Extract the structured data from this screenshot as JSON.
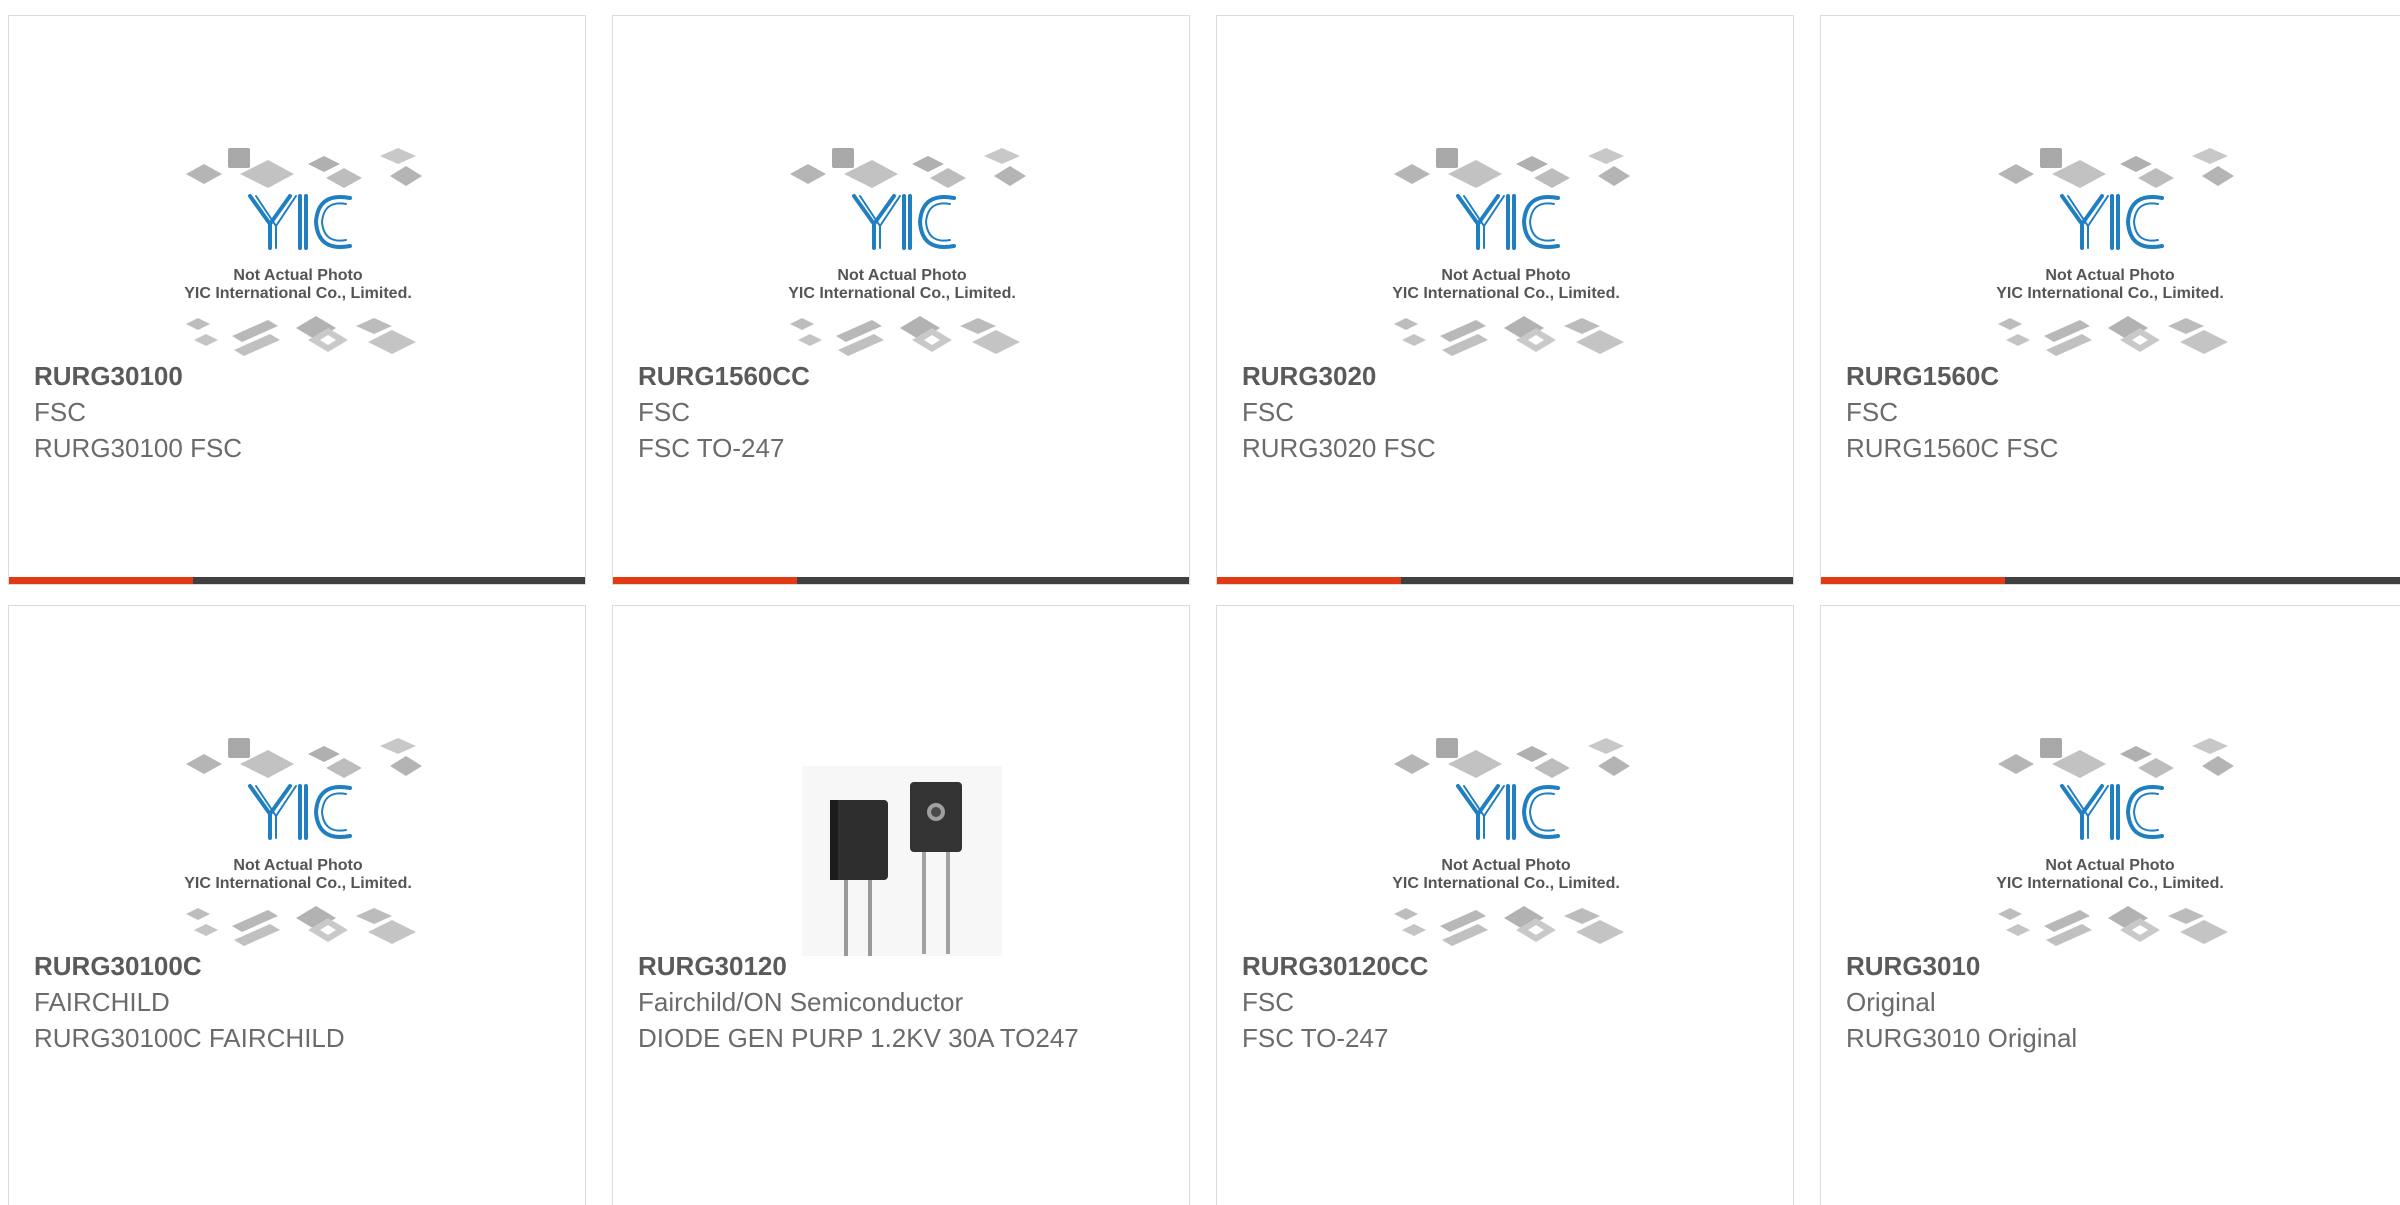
{
  "placeholder": {
    "line1": "Not Actual Photo",
    "line2": "YIC International Co., Limited.",
    "logo": "YIC"
  },
  "colors": {
    "accent": "#e23a12",
    "bar": "#404040",
    "logo": "#1f7fc1",
    "chip": "#b9b9b9"
  },
  "products": [
    {
      "part": "RURG30100",
      "brand": "FSC",
      "desc": "RURG30100 FSC",
      "image": "placeholder"
    },
    {
      "part": "RURG1560CC",
      "brand": "FSC",
      "desc": "FSC TO-247",
      "image": "placeholder"
    },
    {
      "part": "RURG3020",
      "brand": "FSC",
      "desc": "RURG3020 FSC",
      "image": "placeholder"
    },
    {
      "part": "RURG1560C",
      "brand": "FSC",
      "desc": "RURG1560C FSC",
      "image": "placeholder"
    },
    {
      "part": "RURG30100C",
      "brand": "FAIRCHILD",
      "desc": "RURG30100C FAIRCHILD",
      "image": "placeholder"
    },
    {
      "part": "RURG30120",
      "brand": "Fairchild/ON Semiconductor",
      "desc": "DIODE GEN PURP 1.2KV 30A TO247",
      "image": "to247-photo"
    },
    {
      "part": "RURG30120CC",
      "brand": "FSC",
      "desc": "FSC TO-247",
      "image": "placeholder"
    },
    {
      "part": "RURG3010",
      "brand": "Original",
      "desc": "RURG3010 Original",
      "image": "placeholder"
    }
  ]
}
